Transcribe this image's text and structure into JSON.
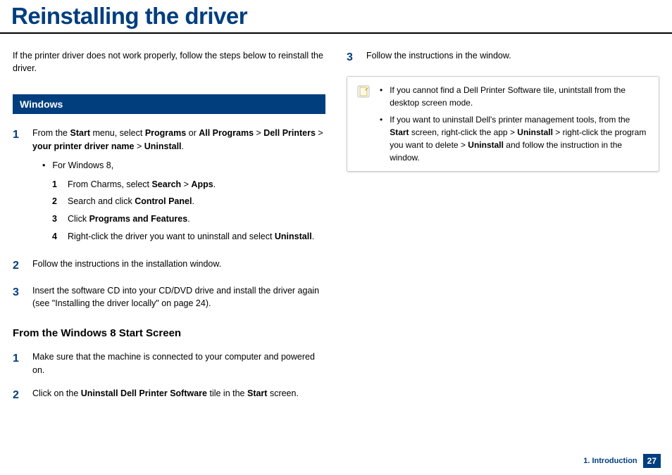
{
  "title": "Reinstalling the driver",
  "intro": "If the printer driver does not work properly, follow the steps below to reinstall the driver.",
  "windows": {
    "heading": "Windows",
    "step1": {
      "prefix": "From the ",
      "b1": "Start",
      "t1": " menu, select ",
      "b2": "Programs",
      "t2": " or ",
      "b3": "All Programs",
      "t3": " > ",
      "b4": "Dell Printers",
      "t4": " > ",
      "b5": "your printer driver name",
      "t5": " > ",
      "b6": "Uninstall",
      "t6": "."
    },
    "sub_bullet": "For Windows 8,",
    "sub1": {
      "pre": "From Charms, select ",
      "b1": "Search",
      "mid": " > ",
      "b2": "Apps",
      "post": "."
    },
    "sub2": {
      "pre": "Search and click ",
      "b1": "Control Panel",
      "post": "."
    },
    "sub3": {
      "pre": "Click ",
      "b1": "Programs and Features",
      "post": "."
    },
    "sub4": {
      "pre": "Right-click the driver you want to uninstall and select ",
      "b1": "Uninstall",
      "post": "."
    },
    "step2": "Follow the instructions in the installation window.",
    "step3": "Insert the software CD into your CD/DVD drive and install the driver again (see \"Installing the driver locally\" on page 24)."
  },
  "win8": {
    "heading": "From the Windows 8 Start Screen",
    "step1": "Make sure that the machine is connected to your computer and powered on.",
    "step2": {
      "pre": "Click on the ",
      "b1": "Uninstall Dell Printer Software",
      "mid": " tile in the ",
      "b2": "Start",
      "post": " screen."
    }
  },
  "right": {
    "step3": "Follow the instructions in the window.",
    "note1": "If you cannot find a Dell Printer Software tile, unintstall from the desktop screen mode.",
    "note2": {
      "pre": "If you want to uninstall Dell's printer management tools, from the ",
      "b1": "Start",
      "t1": " screen, right-click the app > ",
      "b2": "Uninstall",
      "t2": " > right-click the program you want to delete > ",
      "b3": "Uninstall",
      "t3": " and follow the instruction in the window."
    }
  },
  "footer": {
    "chapter": "1. Introduction",
    "page": "27"
  }
}
